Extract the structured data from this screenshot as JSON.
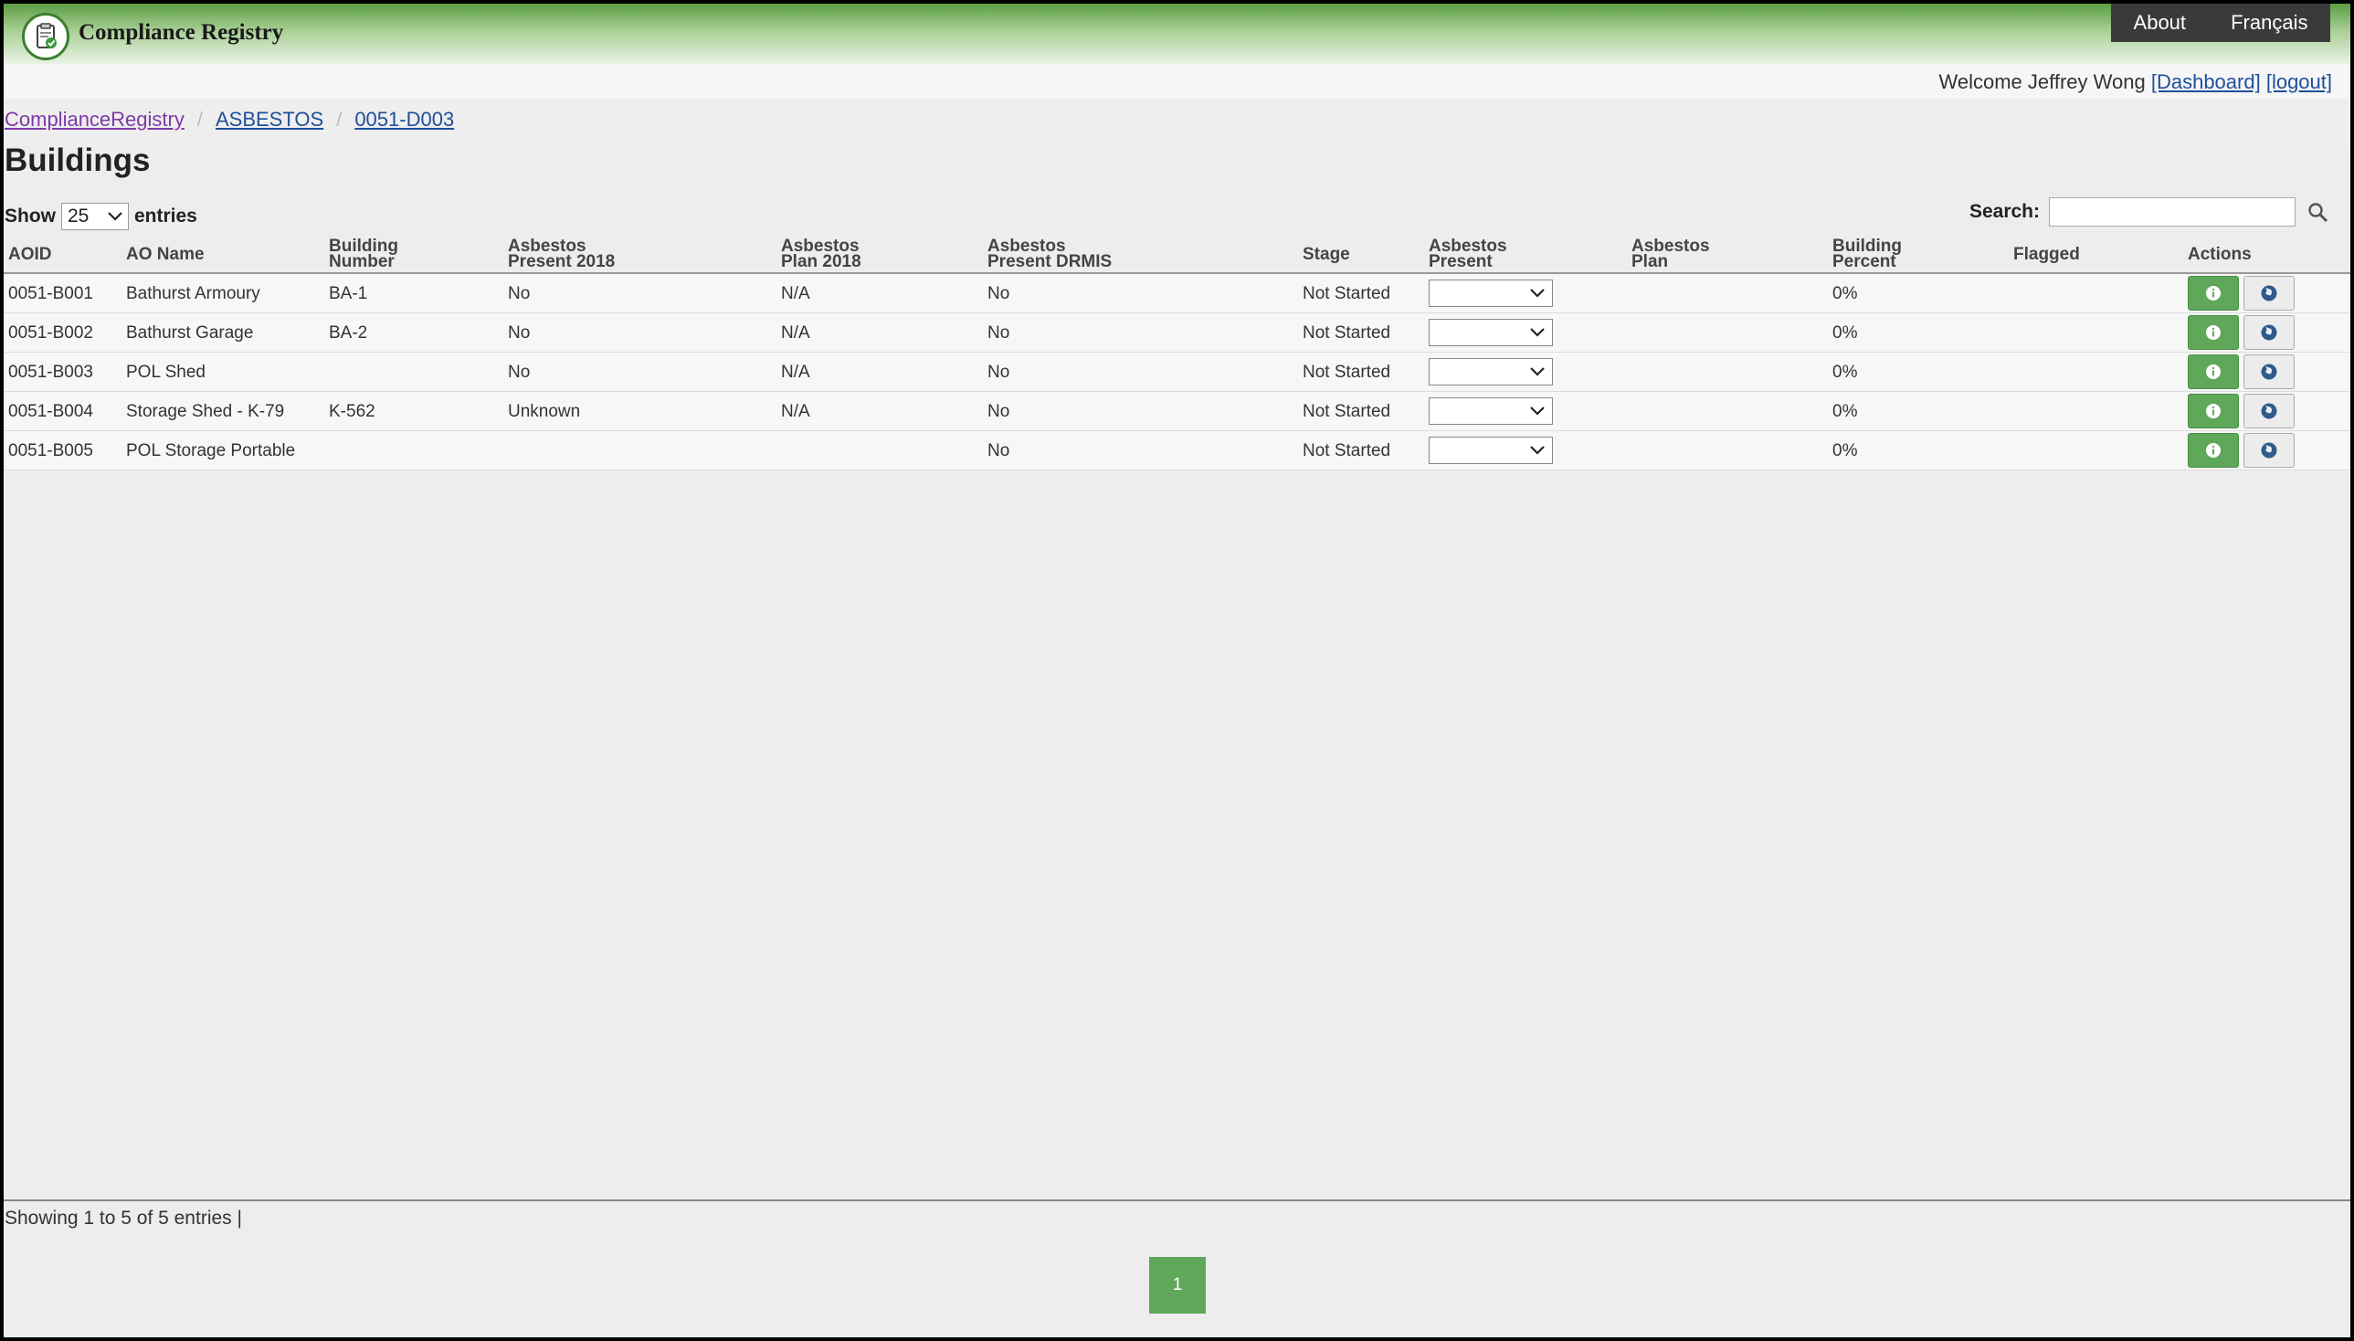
{
  "app": {
    "title": "Compliance Registry"
  },
  "topnav": {
    "about": "About",
    "language": "Français"
  },
  "user": {
    "welcome": "Welcome Jeffrey Wong",
    "dashboard": "[Dashboard]",
    "logout": "[logout]"
  },
  "breadcrumb": {
    "root": "ComplianceRegistry",
    "level1": "ASBESTOS",
    "level2": "0051-D003",
    "separator": "/"
  },
  "page": {
    "title": "Buildings"
  },
  "controls": {
    "show_label": "Show",
    "entries_value": "25",
    "entries_label": "entries",
    "search_label": "Search:",
    "search_value": ""
  },
  "table": {
    "headers": {
      "aoid": "AOID",
      "ao_name": "AO Name",
      "building_number_1": "Building",
      "building_number_2": "Number",
      "present2018_1": "Asbestos",
      "present2018_2": "Present 2018",
      "plan2018_1": "Asbestos",
      "plan2018_2": "Plan 2018",
      "drmis_1": "Asbestos",
      "drmis_2": "Present DRMIS",
      "stage": "Stage",
      "present_1": "Asbestos",
      "present_2": "Present",
      "plan_1": "Asbestos",
      "plan_2": "Plan",
      "percent_1": "Building",
      "percent_2": "Percent",
      "flagged": "Flagged",
      "actions": "Actions"
    },
    "rows": [
      {
        "aoid": "0051-B001",
        "name": "Bathurst Armoury",
        "number": "BA-1",
        "present2018": "No",
        "plan2018": "N/A",
        "drmis": "No",
        "stage": "Not Started",
        "percent": "0%"
      },
      {
        "aoid": "0051-B002",
        "name": "Bathurst Garage",
        "number": "BA-2",
        "present2018": "No",
        "plan2018": "N/A",
        "drmis": "No",
        "stage": "Not Started",
        "percent": "0%"
      },
      {
        "aoid": "0051-B003",
        "name": "POL Shed",
        "number": "",
        "present2018": "No",
        "plan2018": "N/A",
        "drmis": "No",
        "stage": "Not Started",
        "percent": "0%"
      },
      {
        "aoid": "0051-B004",
        "name": "Storage Shed - K-79",
        "number": "K-562",
        "present2018": "Unknown",
        "plan2018": "N/A",
        "drmis": "No",
        "stage": "Not Started",
        "percent": "0%"
      },
      {
        "aoid": "0051-B005",
        "name": "POL Storage Portable",
        "number": "",
        "present2018": "",
        "plan2018": "",
        "drmis": "No",
        "stage": "Not Started",
        "percent": "0%"
      }
    ]
  },
  "footer": {
    "showing": "Showing 1 to 5 of 5 entries |",
    "page": "1"
  },
  "colors": {
    "accent_green": "#5fa85a",
    "link_blue": "#1f4f9a",
    "link_visited": "#7d3aa8",
    "nav_dark": "#3a3a3a"
  },
  "icons": {
    "logo": "clipboard-check-icon",
    "search": "search-icon",
    "info": "info-icon",
    "globe": "globe-icon",
    "dropdown": "chevron-down-icon"
  }
}
